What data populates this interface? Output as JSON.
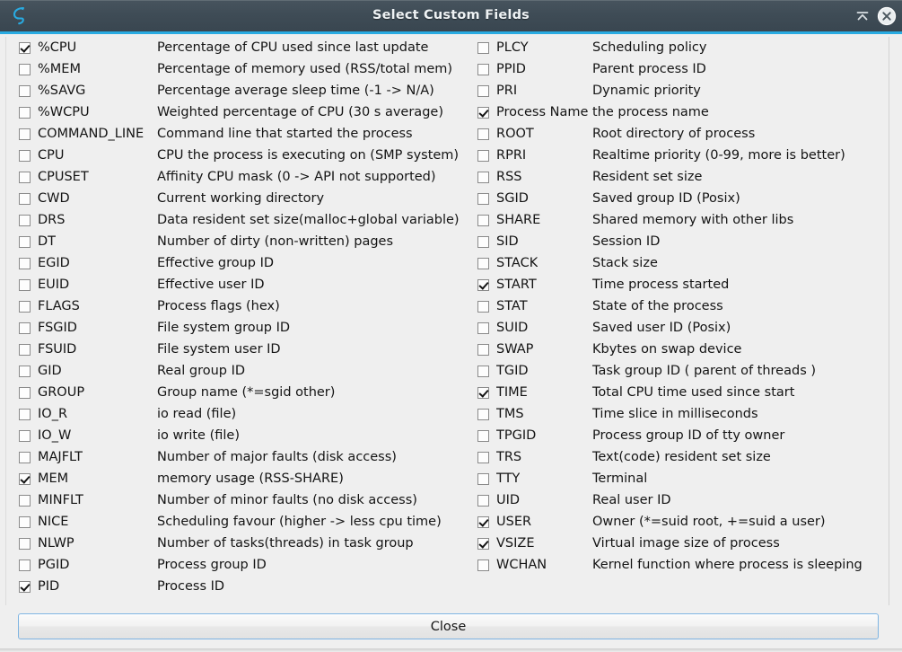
{
  "window": {
    "title": "Select Custom Fields",
    "logo_icon": "glances-logo-icon",
    "accent_color": "#29abe2",
    "titlebar_color": "#3f4c56",
    "content_background": "#efefef",
    "buttons": [
      {
        "name": "shade-button",
        "icon": "window-shade-icon",
        "label": ""
      },
      {
        "name": "close-window-button",
        "icon": "close-circle-icon",
        "label": ""
      }
    ]
  },
  "fields": {
    "left": [
      {
        "name": "%CPU",
        "desc": "Percentage of CPU used since last update",
        "checked": true
      },
      {
        "name": "%MEM",
        "desc": "Percentage of memory used (RSS/total mem)",
        "checked": false
      },
      {
        "name": "%SAVG",
        "desc": "Percentage average sleep time (-1 -> N/A)",
        "checked": false
      },
      {
        "name": "%WCPU",
        "desc": "Weighted percentage of CPU (30 s average)",
        "checked": false
      },
      {
        "name": "COMMAND_LINE",
        "desc": "Command line that started the process",
        "checked": false
      },
      {
        "name": "CPU",
        "desc": "CPU the process is executing on (SMP system)",
        "checked": false
      },
      {
        "name": "CPUSET",
        "desc": "Affinity CPU mask (0 -> API not supported)",
        "checked": false
      },
      {
        "name": "CWD",
        "desc": "Current working directory",
        "checked": false
      },
      {
        "name": "DRS",
        "desc": "Data resident set size(malloc+global variable)",
        "checked": false
      },
      {
        "name": "DT",
        "desc": "Number of dirty (non-written) pages",
        "checked": false
      },
      {
        "name": "EGID",
        "desc": "Effective group ID",
        "checked": false
      },
      {
        "name": "EUID",
        "desc": "Effective user ID",
        "checked": false
      },
      {
        "name": "FLAGS",
        "desc": "Process flags (hex)",
        "checked": false
      },
      {
        "name": "FSGID",
        "desc": "File system group ID",
        "checked": false
      },
      {
        "name": "FSUID",
        "desc": "File system user ID",
        "checked": false
      },
      {
        "name": "GID",
        "desc": "Real group ID",
        "checked": false
      },
      {
        "name": "GROUP",
        "desc": "Group name (*=sgid other)",
        "checked": false
      },
      {
        "name": "IO_R",
        "desc": "io read (file)",
        "checked": false
      },
      {
        "name": "IO_W",
        "desc": "io write (file)",
        "checked": false
      },
      {
        "name": "MAJFLT",
        "desc": "Number of major faults (disk access)",
        "checked": false
      },
      {
        "name": "MEM",
        "desc": "memory usage (RSS-SHARE)",
        "checked": true
      },
      {
        "name": "MINFLT",
        "desc": "Number of minor faults (no disk access)",
        "checked": false
      },
      {
        "name": "NICE",
        "desc": "Scheduling favour (higher -> less cpu time)",
        "checked": false
      },
      {
        "name": "NLWP",
        "desc": "Number of tasks(threads) in task group",
        "checked": false
      },
      {
        "name": "PGID",
        "desc": "Process group ID",
        "checked": false
      },
      {
        "name": "PID",
        "desc": "Process ID",
        "checked": true
      }
    ],
    "right": [
      {
        "name": "PLCY",
        "desc": "Scheduling policy",
        "checked": false
      },
      {
        "name": "PPID",
        "desc": "Parent process ID",
        "checked": false
      },
      {
        "name": "PRI",
        "desc": "Dynamic priority",
        "checked": false
      },
      {
        "name": "Process Name",
        "desc": "the process name",
        "checked": true
      },
      {
        "name": "ROOT",
        "desc": "Root directory of process",
        "checked": false
      },
      {
        "name": "RPRI",
        "desc": "Realtime priority (0-99, more is better)",
        "checked": false
      },
      {
        "name": "RSS",
        "desc": "Resident set size",
        "checked": false
      },
      {
        "name": "SGID",
        "desc": "Saved group ID (Posix)",
        "checked": false
      },
      {
        "name": "SHARE",
        "desc": "Shared memory with other libs",
        "checked": false
      },
      {
        "name": "SID",
        "desc": "Session ID",
        "checked": false
      },
      {
        "name": "STACK",
        "desc": "Stack size",
        "checked": false
      },
      {
        "name": "START",
        "desc": "Time process started",
        "checked": true
      },
      {
        "name": "STAT",
        "desc": "State of the process",
        "checked": false
      },
      {
        "name": "SUID",
        "desc": "Saved user ID (Posix)",
        "checked": false
      },
      {
        "name": "SWAP",
        "desc": "Kbytes on swap device",
        "checked": false
      },
      {
        "name": "TGID",
        "desc": "Task group ID ( parent of threads )",
        "checked": false
      },
      {
        "name": "TIME",
        "desc": "Total CPU time used since start",
        "checked": true
      },
      {
        "name": "TMS",
        "desc": "Time slice in milliseconds",
        "checked": false
      },
      {
        "name": "TPGID",
        "desc": "Process group ID of tty owner",
        "checked": false
      },
      {
        "name": "TRS",
        "desc": "Text(code) resident set size",
        "checked": false
      },
      {
        "name": "TTY",
        "desc": "Terminal",
        "checked": false
      },
      {
        "name": "UID",
        "desc": "Real user ID",
        "checked": false
      },
      {
        "name": "USER",
        "desc": "Owner (*=suid root, +=suid a user)",
        "checked": true
      },
      {
        "name": "VSIZE",
        "desc": "Virtual image size of process",
        "checked": true
      },
      {
        "name": "WCHAN",
        "desc": "Kernel function where process is sleeping",
        "checked": false
      }
    ]
  },
  "footer": {
    "close_label": "Close"
  }
}
